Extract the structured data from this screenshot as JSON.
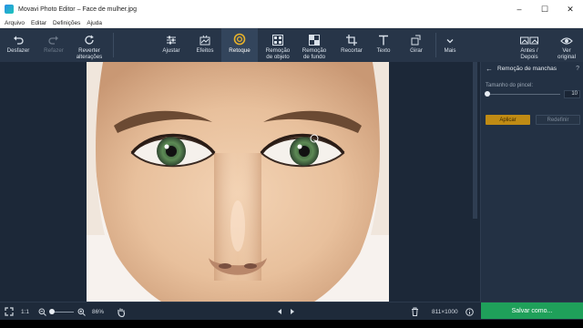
{
  "window": {
    "title": "Movavi Photo Editor – Face de mulher.jpg",
    "minimize": "–",
    "maximize": "☐",
    "close": "✕"
  },
  "menu": [
    "Arquivo",
    "Editar",
    "Definições",
    "Ajuda"
  ],
  "toolbar": {
    "undo": "Desfazer",
    "redo": "Refazer",
    "revert": "Reverter\nalterações",
    "adjust": "Ajustar",
    "effects": "Efeitos",
    "retouch": "Retoque",
    "object_removal": "Remoção\nde objeto",
    "bg_removal": "Remoção\nde fundo",
    "crop": "Recortar",
    "text": "Texto",
    "rotate": "Girar",
    "more": "Mais",
    "before_after": "Antes /\nDepois",
    "original": "Ver\noriginal"
  },
  "panel": {
    "title": "Remoção de manchas",
    "help": "?",
    "brush_label": "Tamanho do pincel:",
    "brush_size": "10",
    "apply": "Aplicar",
    "reset": "Redefinir"
  },
  "bottombar": {
    "ratio": "1:1",
    "zoom": "86%",
    "dimensions": "811×1000",
    "save": "Salvar como..."
  },
  "colors": {
    "toolbar_bg": "#273548",
    "workspace_bg": "#1c2838",
    "apply_button": "#c08b14",
    "save_button": "#1fa05a"
  }
}
